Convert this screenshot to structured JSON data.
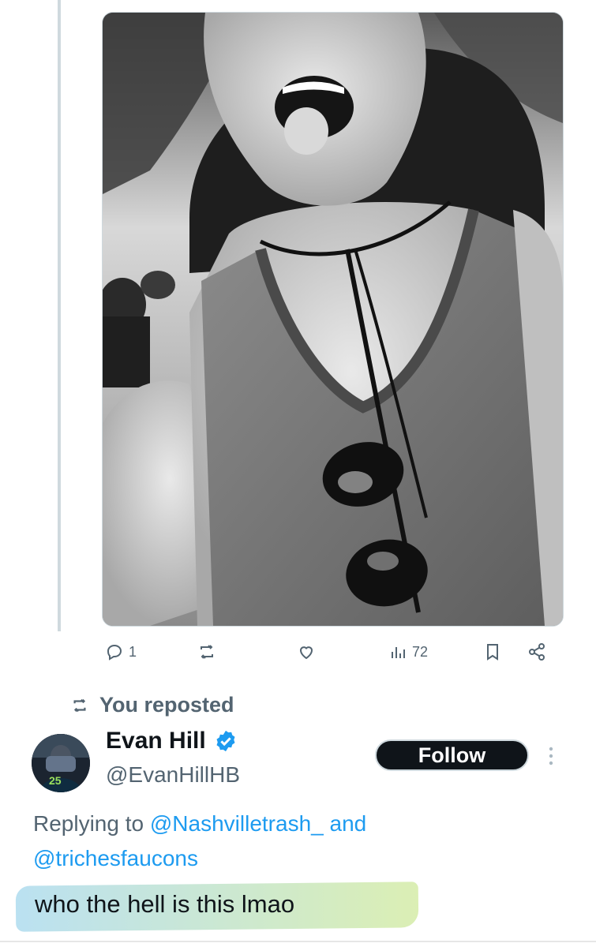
{
  "media": {
    "alt": ""
  },
  "actions": {
    "reply_count": "1",
    "repost_count": "",
    "like_count": "",
    "views_count": "72"
  },
  "repost_banner": {
    "text": "You reposted"
  },
  "author": {
    "display_name": "Evan Hill",
    "handle": "@EvanHillHB",
    "verified": true
  },
  "follow_button": {
    "label": "Follow"
  },
  "reply_context": {
    "prefix": "Replying to ",
    "mention1": "@Nashvilletrash_",
    "joiner": " and",
    "mention2": "@trichesfaucons"
  },
  "tweet": {
    "text": "who the hell is this lmao"
  },
  "colors": {
    "accent": "#1d9bf0",
    "text": "#0f1419",
    "muted": "#536471",
    "follow_bg": "#0f1419"
  },
  "icons": [
    "reply-icon",
    "repost-icon",
    "like-icon",
    "views-icon",
    "bookmark-icon",
    "share-icon",
    "verified-badge-icon",
    "more-icon"
  ]
}
